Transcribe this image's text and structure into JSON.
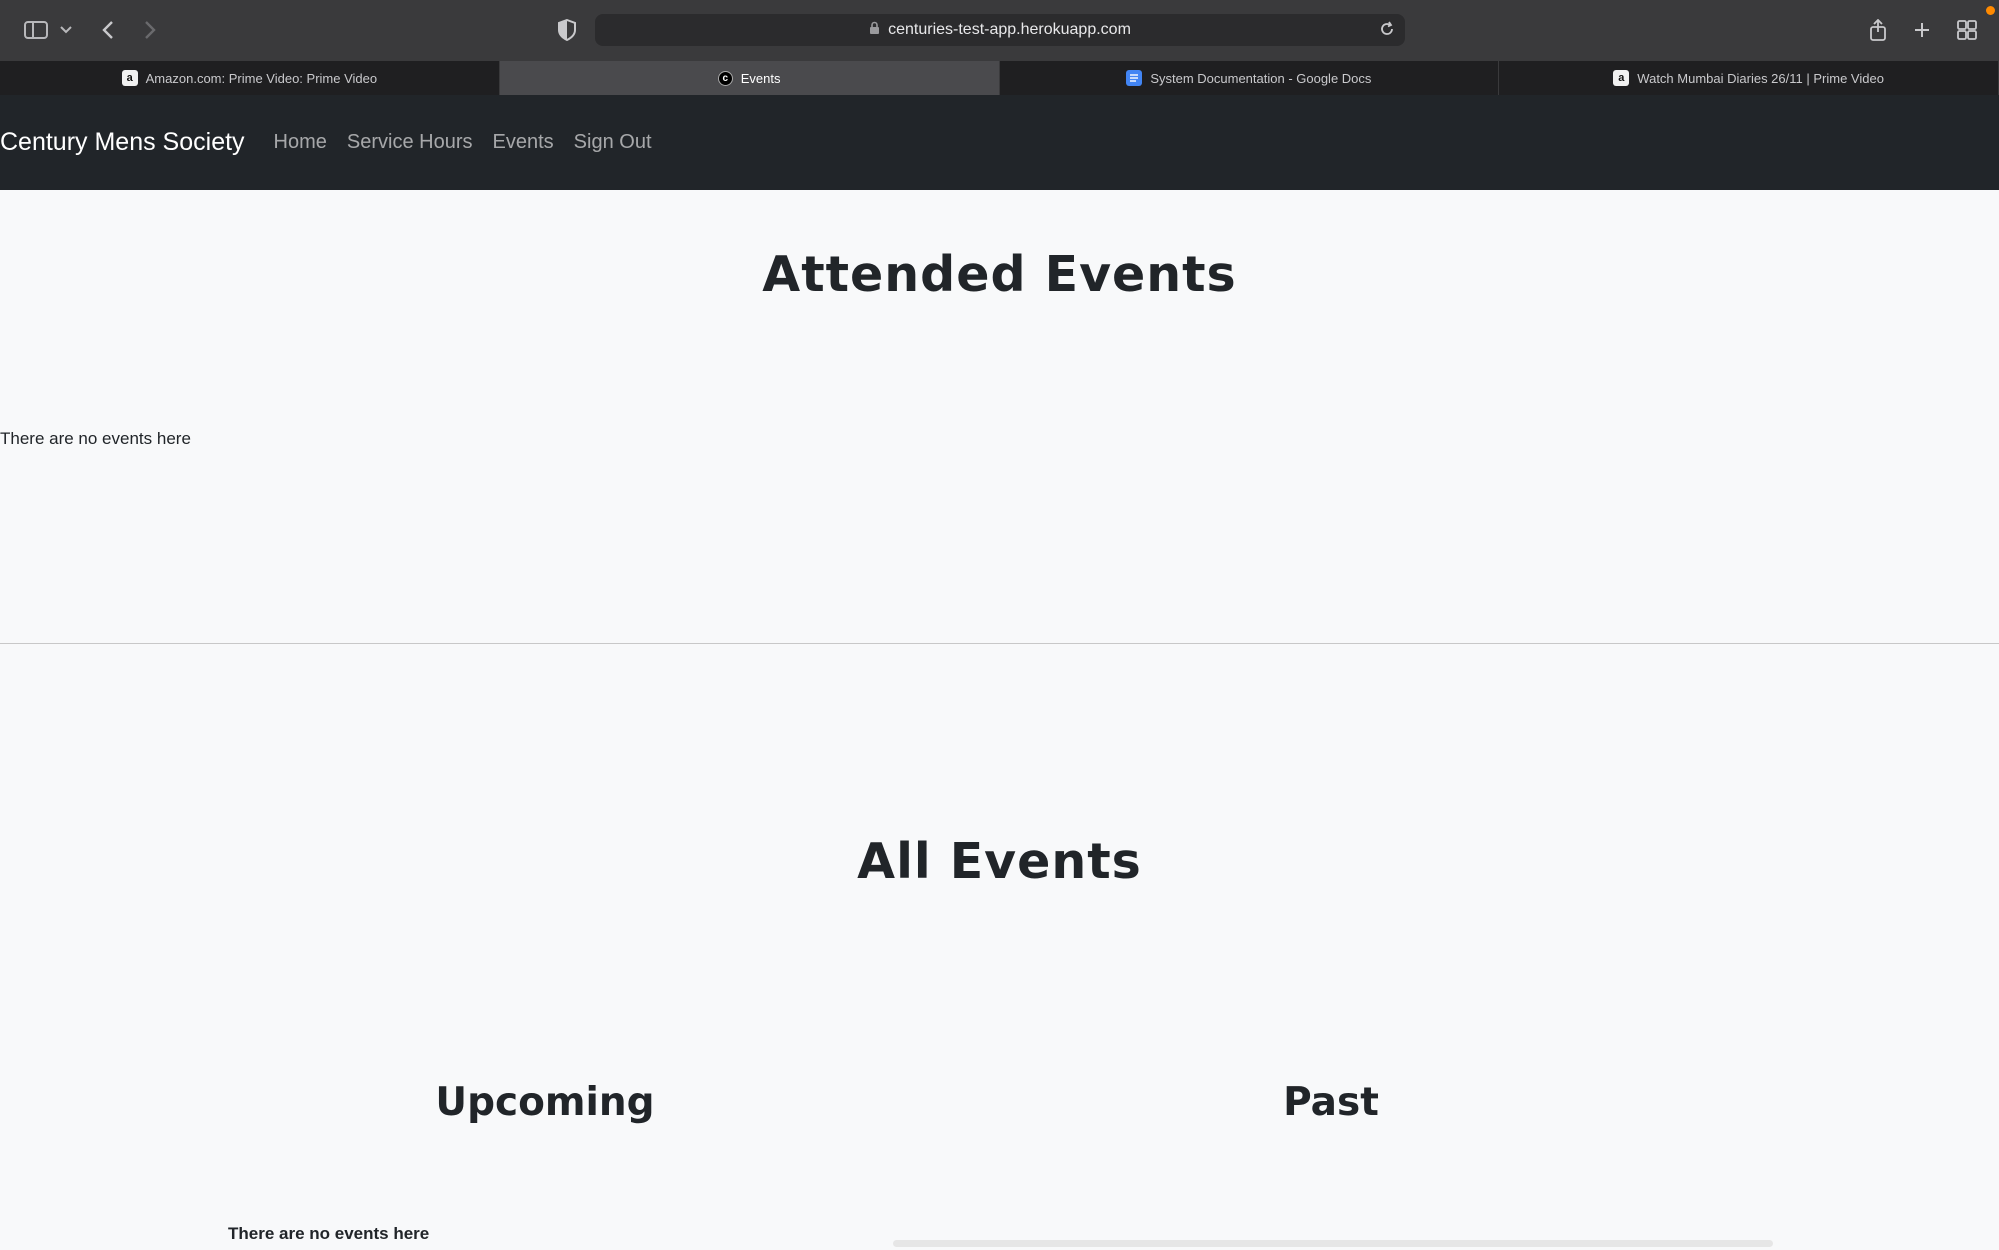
{
  "browser": {
    "url": "centuries-test-app.herokuapp.com",
    "tabs": [
      {
        "label": "Amazon.com: Prime Video: Prime Video",
        "icon": "amazon-icon"
      },
      {
        "label": "Events",
        "icon": "c-logo-icon"
      },
      {
        "label": "System Documentation - Google Docs",
        "icon": "google-docs-icon"
      },
      {
        "label": "Watch Mumbai Diaries 26/11 | Prime Video",
        "icon": "amazon-icon"
      }
    ],
    "favicons": {
      "amazon": "a",
      "c": "c"
    }
  },
  "navbar": {
    "brand": "Century Mens Society",
    "links": [
      "Home",
      "Service Hours",
      "Events",
      "Sign Out"
    ]
  },
  "attended": {
    "title": "Attended Events",
    "empty": "There are no events here"
  },
  "all": {
    "title": "All Events",
    "upcoming_title": "Upcoming",
    "past_title": "Past",
    "upcoming_empty": "There are no events here"
  },
  "colors": {
    "navbar": "#212529",
    "accent_dot": "#ff8a00"
  }
}
